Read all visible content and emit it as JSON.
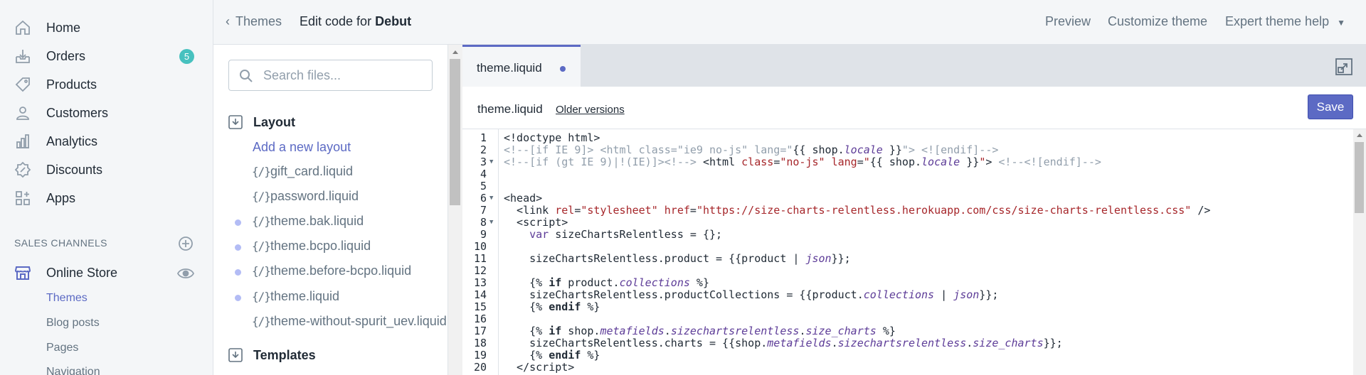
{
  "nav": {
    "items": [
      {
        "label": "Home",
        "icon": "home-icon"
      },
      {
        "label": "Orders",
        "icon": "orders-icon",
        "badge": "5"
      },
      {
        "label": "Products",
        "icon": "tag-icon"
      },
      {
        "label": "Customers",
        "icon": "person-icon"
      },
      {
        "label": "Analytics",
        "icon": "bar-chart-icon"
      },
      {
        "label": "Discounts",
        "icon": "discount-icon"
      },
      {
        "label": "Apps",
        "icon": "apps-icon"
      }
    ],
    "sales_channels_heading": "SALES CHANNELS",
    "online_store": "Online Store",
    "sub_items": [
      "Themes",
      "Blog posts",
      "Pages",
      "Navigation"
    ],
    "active_sub_item": "Themes"
  },
  "topbar": {
    "back_label": "Themes",
    "title_prefix": "Edit code for",
    "theme_name": "Debut",
    "preview": "Preview",
    "customize": "Customize theme",
    "expert_help": "Expert theme help"
  },
  "files": {
    "search_placeholder": "Search files...",
    "layout_folder": "Layout",
    "add_layout": "Add a new layout",
    "layout_files": [
      {
        "name": "gift_card.liquid",
        "modified": false
      },
      {
        "name": "password.liquid",
        "modified": false
      },
      {
        "name": "theme.bak.liquid",
        "modified": true
      },
      {
        "name": "theme.bcpo.liquid",
        "modified": true
      },
      {
        "name": "theme.before-bcpo.liquid",
        "modified": true
      },
      {
        "name": "theme.liquid",
        "modified": true
      },
      {
        "name": "theme-without-spurit_uev.liquid",
        "modified": false
      }
    ],
    "file_icon_glyph": "{/}",
    "templates_folder": "Templates"
  },
  "editor": {
    "tab_label": "theme.liquid",
    "file_name": "theme.liquid",
    "older_versions": "Older versions",
    "save_label": "Save",
    "line_numbers": [
      "1",
      "2",
      "3",
      "4",
      "5",
      "6",
      "7",
      "8",
      "9",
      "10",
      "11",
      "12",
      "13",
      "14",
      "15",
      "16",
      "17",
      "18",
      "19",
      "20"
    ]
  },
  "colors": {
    "accent": "#5c6ac4",
    "badge": "#47c1bf",
    "modified_dot": "#b3bcf5",
    "string": "#a6262a",
    "comment": "#919eab"
  }
}
